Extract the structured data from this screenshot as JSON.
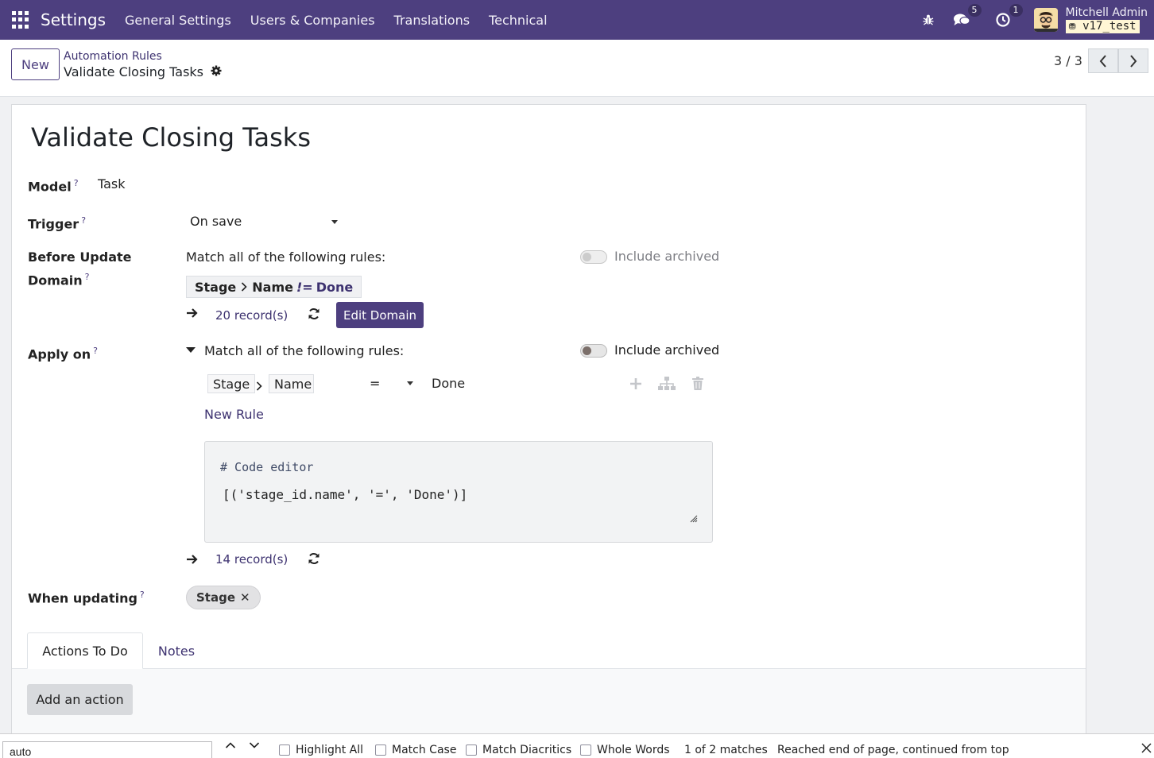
{
  "navbar": {
    "brand": "Settings",
    "menu": [
      "General Settings",
      "Users & Companies",
      "Translations",
      "Technical"
    ],
    "messages_count": "5",
    "activities_count": "1",
    "user_name": "Mitchell Admin",
    "db_name": "v17_test"
  },
  "control": {
    "new_label": "New",
    "breadcrumb_parent": "Automation Rules",
    "breadcrumb_current": "Validate Closing Tasks",
    "pager": "3 / 3"
  },
  "form": {
    "title": "Validate Closing Tasks",
    "model_label": "Model",
    "model_value": "Task",
    "trigger_label": "Trigger",
    "trigger_value": "On save",
    "before_label_1": "Before Update",
    "before_label_2": "Domain",
    "before_match_text": "Match all of the following rules:",
    "include_archived": "Include archived",
    "domain_chip": {
      "field_1": "Stage",
      "field_2": "Name",
      "operator": "!=",
      "value": "Done"
    },
    "before_records": "20 record(s)",
    "edit_domain_label": "Edit Domain",
    "apply_label": "Apply on",
    "apply_match_text": "Match all of the following rules:",
    "rule": {
      "path_1": "Stage",
      "path_2": "Name",
      "operator": "=",
      "value": "Done"
    },
    "new_rule_label": "New Rule",
    "code_comment": "# Code editor",
    "code_line": "[('stage_id.name', '=', 'Done')]",
    "apply_records": "14 record(s)",
    "when_updating_label": "When updating",
    "when_updating_tag": "Stage"
  },
  "tabs": {
    "actions": "Actions To Do",
    "notes": "Notes"
  },
  "add_action_label": "Add an action",
  "findbar": {
    "query": "auto",
    "highlight_all": "Highlight All",
    "match_case": "Match Case",
    "match_diacritics": "Match Diacritics",
    "whole_words": "Whole Words",
    "matches": "1 of 2 matches",
    "status": "Reached end of page, continued from top"
  },
  "colors": {
    "navbar": "#4d3f7f",
    "primary": "#4d3f7f",
    "link": "#3d3270"
  }
}
